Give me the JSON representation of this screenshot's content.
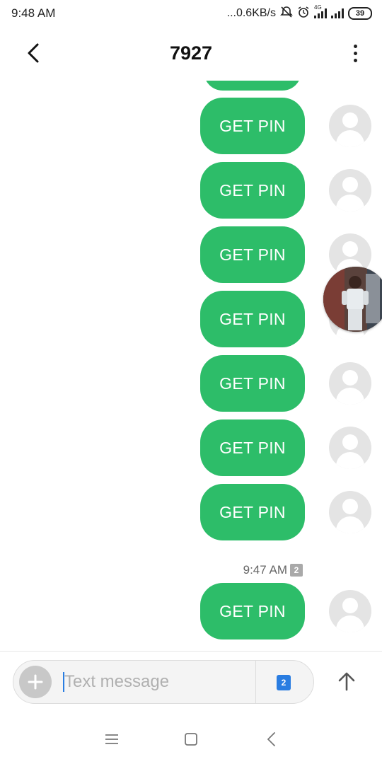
{
  "status_bar": {
    "time": "9:48 AM",
    "speed": "...0.6KB/s",
    "network": "4G",
    "battery": "39"
  },
  "header": {
    "title": "7927",
    "back_icon": "chevron-left-icon",
    "menu_icon": "more-vertical-icon"
  },
  "messages": [
    {
      "text": "GET PIN"
    },
    {
      "text": "GET PIN"
    },
    {
      "text": "GET PIN"
    },
    {
      "text": "GET PIN"
    },
    {
      "text": "GET PIN"
    },
    {
      "text": "GET PIN"
    },
    {
      "text": "GET PIN"
    },
    {
      "text": "GET PIN"
    }
  ],
  "timestamp": {
    "time": "9:47 AM",
    "sim": "2"
  },
  "compose": {
    "placeholder": "Text message",
    "sim_label": "2",
    "add_icon": "plus-icon",
    "send_icon": "arrow-up-icon"
  },
  "nav_bar": {
    "items": [
      "menu-icon",
      "home-square-icon",
      "back-chevron-icon"
    ]
  },
  "colors": {
    "bubble": "#2dbd69",
    "accent": "#2a7de1",
    "avatar_bg": "#e4e4e4"
  }
}
